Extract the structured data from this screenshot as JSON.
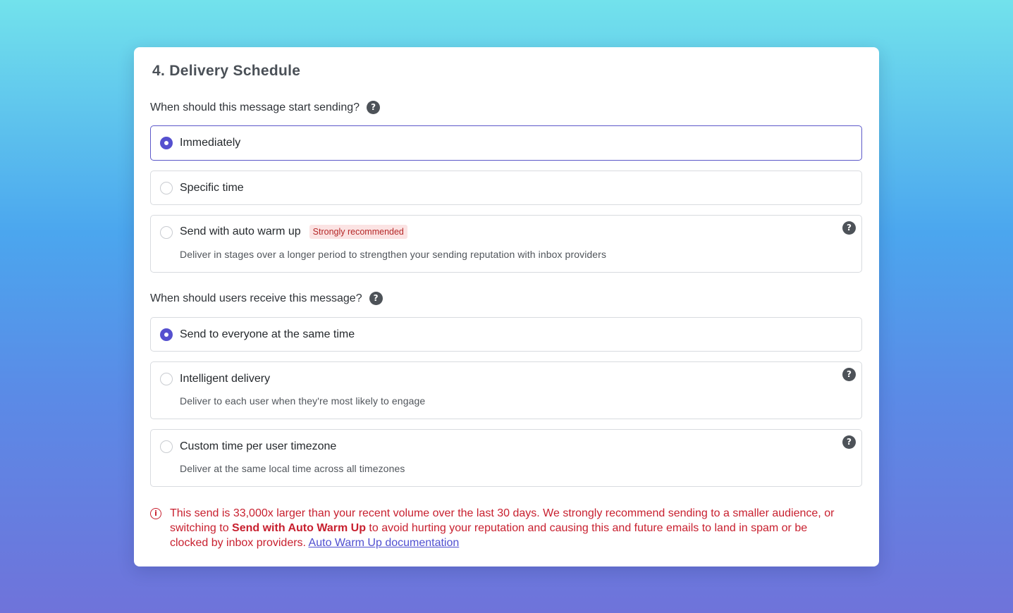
{
  "section": {
    "title": "4. Delivery Schedule"
  },
  "start_sending": {
    "question": "When should this message start sending?",
    "options": [
      {
        "label": "Immediately",
        "selected": true
      },
      {
        "label": "Specific time",
        "selected": false
      },
      {
        "label": "Send with auto warm up",
        "badge": "Strongly recommended",
        "description": "Deliver in stages over a longer period to strengthen your sending reputation with inbox providers",
        "selected": false
      }
    ]
  },
  "receive": {
    "question": "When should users receive this message?",
    "options": [
      {
        "label": "Send to everyone at the same time",
        "selected": true
      },
      {
        "label": "Intelligent delivery",
        "description": "Deliver to each user when they're most likely to engage",
        "selected": false
      },
      {
        "label": "Custom time per user timezone",
        "description": "Deliver at the same local time across all timezones",
        "selected": false
      }
    ]
  },
  "warning": {
    "text_before": "This send is 33,000x larger than your recent volume over the last 30 days. We strongly recommend sending to a smaller audience, or switching to ",
    "bold": "Send with Auto Warm Up",
    "text_after": " to avoid hurting your reputation and causing this and future emails to land in spam or be clocked by inbox providers. ",
    "link": "Auto Warm Up documentation"
  },
  "icons": {
    "help": "?",
    "warning": "i"
  },
  "colors": {
    "accent": "#5550cf",
    "warning": "#c8202f",
    "badge_bg": "#fbe3e3",
    "badge_text": "#b52828"
  }
}
